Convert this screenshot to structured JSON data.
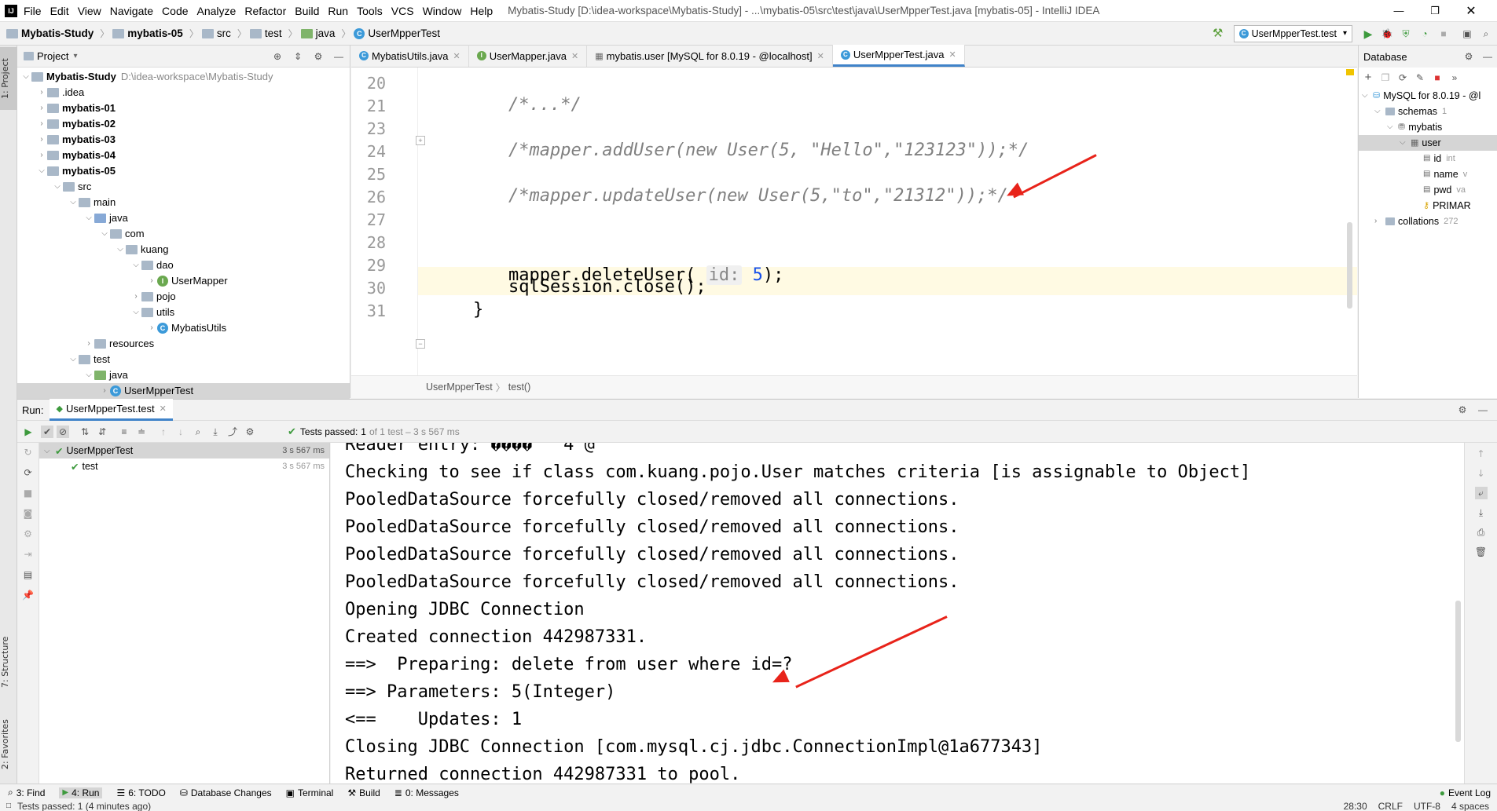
{
  "window": {
    "title": "Mybatis-Study [D:\\idea-workspace\\Mybatis-Study] - ...\\mybatis-05\\src\\test\\java\\UserMpperTest.java [mybatis-05] - IntelliJ IDEA",
    "menu": [
      "File",
      "Edit",
      "View",
      "Navigate",
      "Code",
      "Analyze",
      "Refactor",
      "Build",
      "Run",
      "Tools",
      "VCS",
      "Window",
      "Help"
    ]
  },
  "breadcrumb": [
    "Mybatis-Study",
    "mybatis-05",
    "src",
    "test",
    "java",
    "UserMpperTest"
  ],
  "run_config": "UserMpperTest.test",
  "project_panel": {
    "title": "Project",
    "root": {
      "name": "Mybatis-Study",
      "path": "D:\\idea-workspace\\Mybatis-Study"
    },
    "items": [
      "idea",
      "mybatis-01",
      "mybatis-02",
      "mybatis-03",
      "mybatis-04",
      "mybatis-05",
      "src",
      "main",
      "java",
      "com",
      "kuang",
      "dao",
      "UserMapper",
      "pojo",
      "utils",
      "MybatisUtils",
      "resources",
      "test",
      "java",
      "UserMpperTest"
    ]
  },
  "editor": {
    "tabs": [
      "MybatisUtils.java",
      "UserMapper.java",
      "mybatis.user [MySQL for 8.0.19 - @localhost]",
      "UserMpperTest.java"
    ],
    "lines": [
      {
        "n": "20",
        "text": ""
      },
      {
        "n": "21",
        "text": "/*...*/"
      },
      {
        "n": "23",
        "text": ""
      },
      {
        "n": "24",
        "text": "/*mapper.addUser(new User(5, \"Hello\",\"123123\"));*/"
      },
      {
        "n": "25",
        "text": ""
      },
      {
        "n": "26",
        "text": "/*mapper.updateUser(new User(5,\"to\",\"21312\"));*/"
      },
      {
        "n": "27",
        "text": ""
      },
      {
        "n": "28",
        "text": ""
      },
      {
        "n": "29",
        "text": ""
      },
      {
        "n": "30",
        "text": "sqlSession.close();"
      },
      {
        "n": "31",
        "text": "}"
      }
    ],
    "line28": {
      "pre": "mapper.deleteUser(",
      "hint": "id:",
      "arg": "5",
      "post": ");"
    },
    "breadcrumb": [
      "UserMpperTest",
      "test()"
    ]
  },
  "database": {
    "title": "Database",
    "items": [
      {
        "label": "MySQL for 8.0.19 - @l",
        "type": ""
      },
      {
        "label": "schemas",
        "type": "1"
      },
      {
        "label": "mybatis",
        "type": ""
      },
      {
        "label": "user",
        "type": ""
      },
      {
        "label": "id",
        "type": "int"
      },
      {
        "label": "name",
        "type": "v"
      },
      {
        "label": "pwd",
        "type": "va"
      },
      {
        "label": "PRIMAR",
        "type": ""
      },
      {
        "label": "collations",
        "type": "272"
      }
    ]
  },
  "run": {
    "label": "Run:",
    "tab": "UserMpperTest.test",
    "status": {
      "passed": "Tests passed:",
      "count": "1",
      "rest": "of 1 test – 3 s 567 ms"
    },
    "tree": [
      {
        "name": "UserMpperTest",
        "time": "3 s 567 ms"
      },
      {
        "name": "test",
        "time": "3 s 567 ms"
      }
    ],
    "console": [
      "Reader entry: ����   4 @",
      "Checking to see if class com.kuang.pojo.User matches criteria [is assignable to Object]",
      "PooledDataSource forcefully closed/removed all connections.",
      "PooledDataSource forcefully closed/removed all connections.",
      "PooledDataSource forcefully closed/removed all connections.",
      "PooledDataSource forcefully closed/removed all connections.",
      "Opening JDBC Connection",
      "Created connection 442987331.",
      "==>  Preparing: delete from user where id=?",
      "==> Parameters: 5(Integer)",
      "<==    Updates: 1",
      "Closing JDBC Connection [com.mysql.cj.jdbc.ConnectionImpl@1a677343]",
      "Returned connection 442987331 to pool."
    ]
  },
  "left_tabs": [
    "1: Project",
    "7: Structure",
    "2: Favorites"
  ],
  "tool_windows": [
    "3: Find",
    "4: Run",
    "6: TODO",
    "Database Changes",
    "Terminal",
    "Build",
    "0: Messages"
  ],
  "event_log": "Event Log",
  "status_bar": {
    "message": "Tests passed: 1 (4 minutes ago)",
    "position": "28:30",
    "line_sep": "CRLF",
    "encoding": "UTF-8",
    "indent": "4 spaces"
  },
  "colors": {
    "accent": "#4083c9",
    "arrow": "#e8231a",
    "passed": "#3d9a3d"
  }
}
